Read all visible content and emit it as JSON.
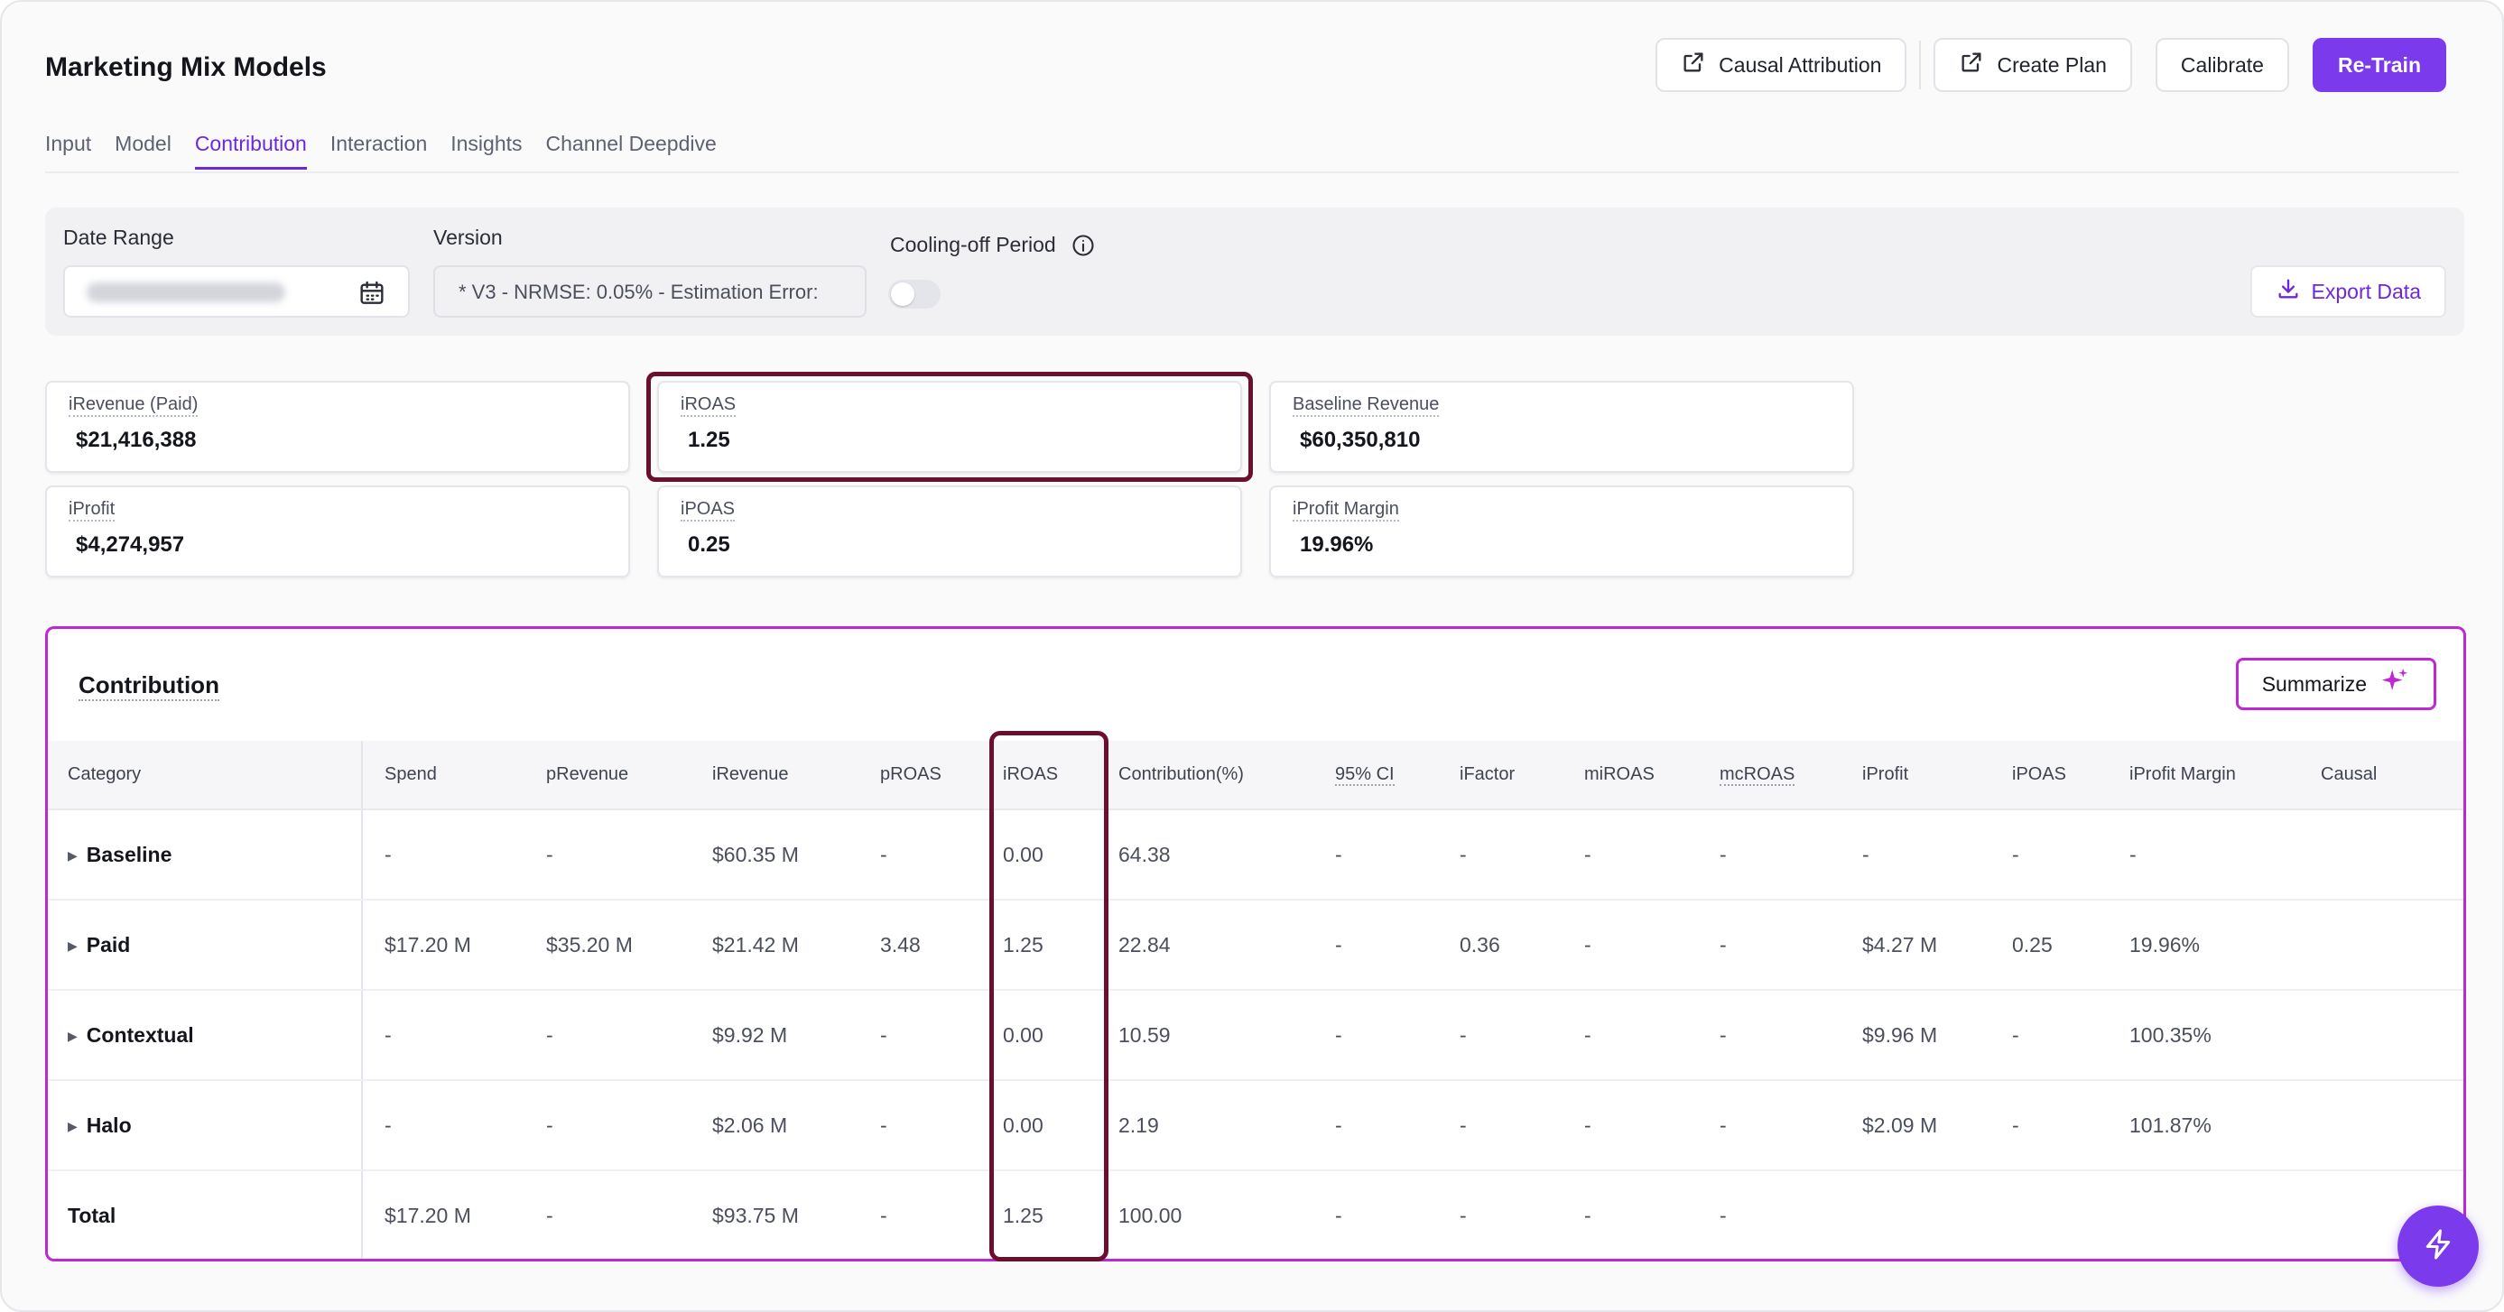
{
  "header": {
    "title": "Marketing Mix Models",
    "actions": {
      "causal_attribution": "Causal Attribution",
      "create_plan": "Create Plan",
      "calibrate": "Calibrate",
      "retrain": "Re-Train"
    }
  },
  "tabs": [
    {
      "label": "Input"
    },
    {
      "label": "Model"
    },
    {
      "label": "Contribution",
      "active": true
    },
    {
      "label": "Interaction"
    },
    {
      "label": "Insights"
    },
    {
      "label": "Channel Deepdive"
    }
  ],
  "filters": {
    "date_range_label": "Date Range",
    "version_label": "Version",
    "version_value": "* V3 - NRMSE: 0.05% - Estimation Error:",
    "cooling_off_label": "Cooling-off Period",
    "cooling_off_enabled": false,
    "export_label": "Export Data"
  },
  "kpis": [
    {
      "label": "iRevenue (Paid)",
      "value": "$21,416,388"
    },
    {
      "label": "iROAS",
      "value": "1.25"
    },
    {
      "label": "Baseline Revenue",
      "value": "$60,350,810"
    },
    {
      "label": "iProfit",
      "value": "$4,274,957"
    },
    {
      "label": "iPOAS",
      "value": "0.25"
    },
    {
      "label": "iProfit Margin",
      "value": "19.96%"
    }
  ],
  "contribution": {
    "title": "Contribution",
    "summarize_label": "Summarize",
    "columns": [
      "Category",
      "Spend",
      "pRevenue",
      "iRevenue",
      "pROAS",
      "iROAS",
      "Contribution(%)",
      "95% CI",
      "iFactor",
      "miROAS",
      "mcROAS",
      "iProfit",
      "iPOAS",
      "iProfit Margin",
      "Causal"
    ],
    "rows": [
      {
        "category": "Baseline",
        "expandable": true,
        "cells": [
          "-",
          "-",
          "$60.35 M",
          "-",
          "0.00",
          "64.38",
          "-",
          "-",
          "-",
          "-",
          "-",
          "-",
          "-",
          ""
        ]
      },
      {
        "category": "Paid",
        "expandable": true,
        "cells": [
          "$17.20 M",
          "$35.20 M",
          "$21.42 M",
          "3.48",
          "1.25",
          "22.84",
          "-",
          "0.36",
          "-",
          "-",
          "$4.27 M",
          "0.25",
          "19.96%",
          ""
        ]
      },
      {
        "category": "Contextual",
        "expandable": true,
        "cells": [
          "-",
          "-",
          "$9.92 M",
          "-",
          "0.00",
          "10.59",
          "-",
          "-",
          "-",
          "-",
          "$9.96 M",
          "-",
          "100.35%",
          ""
        ]
      },
      {
        "category": "Halo",
        "expandable": true,
        "cells": [
          "-",
          "-",
          "$2.06 M",
          "-",
          "0.00",
          "2.19",
          "-",
          "-",
          "-",
          "-",
          "$2.09 M",
          "-",
          "101.87%",
          ""
        ]
      },
      {
        "category": "Total",
        "expandable": false,
        "cells": [
          "$17.20 M",
          "-",
          "$93.75 M",
          "-",
          "1.25",
          "100.00",
          "-",
          "-",
          "-",
          "-",
          "",
          "",
          "",
          ""
        ]
      }
    ]
  },
  "colors": {
    "accent": "#7c3aed",
    "highlight": "#6b0f2e",
    "panel_border": "#c026d3"
  }
}
